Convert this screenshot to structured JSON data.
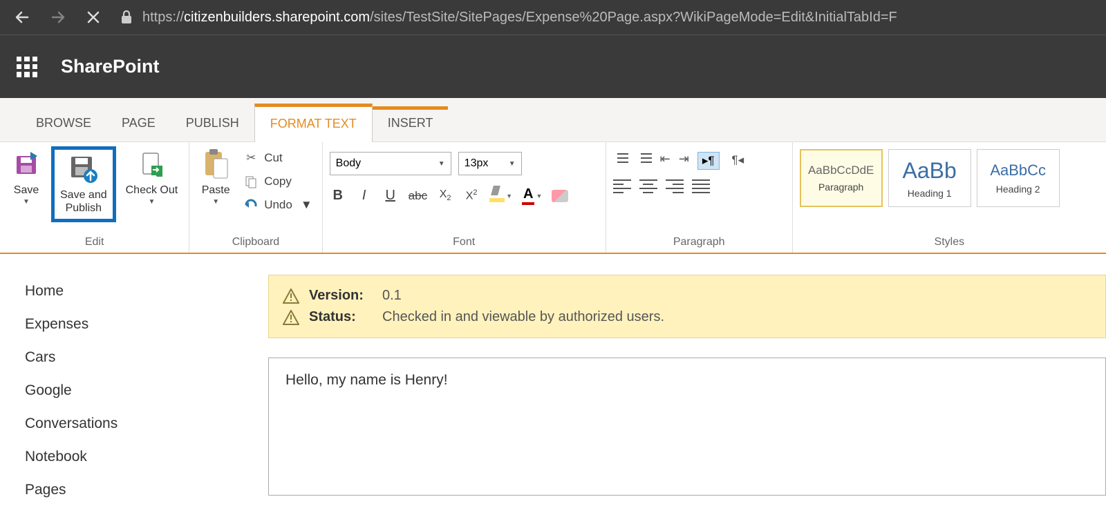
{
  "browser": {
    "url_prefix": "https://",
    "url_host": "citizenbuilders.sharepoint.com",
    "url_path": "/sites/TestSite/SitePages/Expense%20Page.aspx?WikiPageMode=Edit&InitialTabId=F"
  },
  "suite": {
    "brand": "SharePoint"
  },
  "tabs": {
    "browse": "BROWSE",
    "page": "PAGE",
    "publish": "PUBLISH",
    "format_text": "FORMAT TEXT",
    "insert": "INSERT"
  },
  "ribbon": {
    "edit": {
      "group": "Edit",
      "save": "Save",
      "save_publish": "Save and\nPublish",
      "check_out": "Check Out"
    },
    "clipboard": {
      "group": "Clipboard",
      "paste": "Paste",
      "cut": "Cut",
      "copy": "Copy",
      "undo": "Undo"
    },
    "font": {
      "group": "Font",
      "family": "Body",
      "size": "13px"
    },
    "paragraph": {
      "group": "Paragraph"
    },
    "styles": {
      "group": "Styles",
      "items": [
        {
          "sample": "AaBbCcDdE",
          "name": "Paragraph",
          "cls": "par"
        },
        {
          "sample": "AaBb",
          "name": "Heading 1",
          "cls": "h1"
        },
        {
          "sample": "AaBbCc",
          "name": "Heading 2",
          "cls": "h2"
        }
      ]
    }
  },
  "sidebar": {
    "items": [
      "Home",
      "Expenses",
      "Cars",
      "Google",
      "Conversations",
      "Notebook",
      "Pages"
    ]
  },
  "status": {
    "version_label": "Version:",
    "version_value": "0.1",
    "status_label": "Status:",
    "status_value": "Checked in and viewable by authorized users."
  },
  "editor": {
    "content": "Hello, my name is Henry!"
  }
}
